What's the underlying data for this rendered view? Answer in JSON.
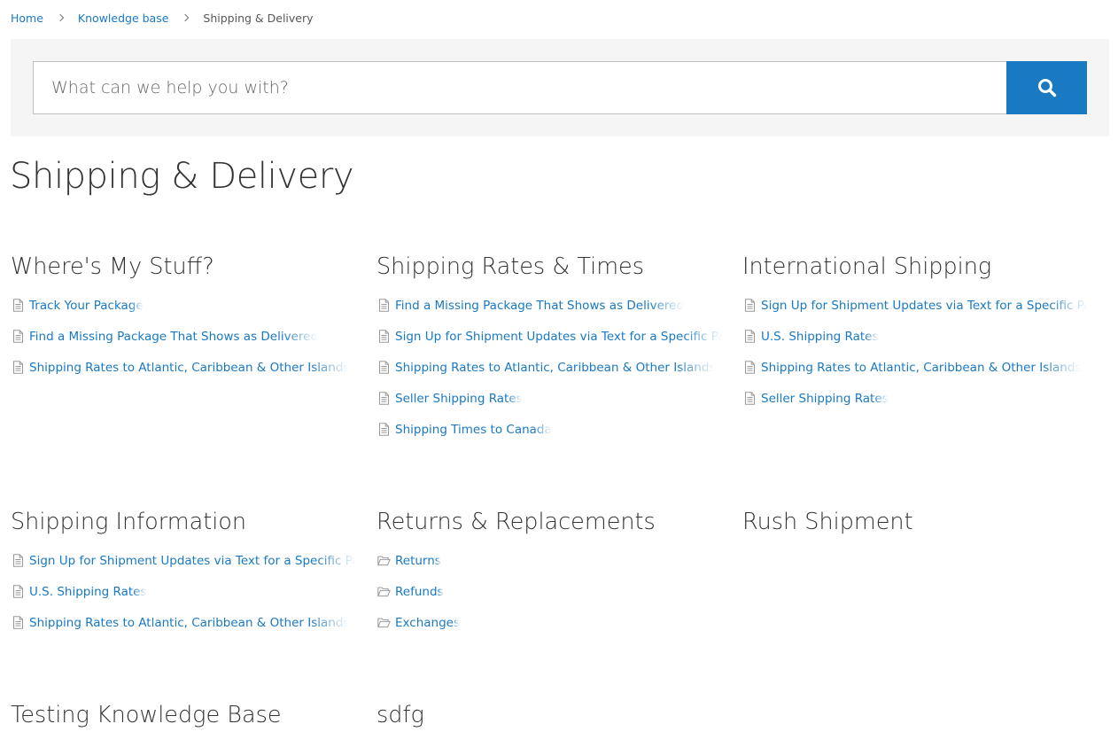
{
  "breadcrumb": {
    "home": "Home",
    "knowledge_base": "Knowledge base",
    "current": "Shipping & Delivery"
  },
  "search": {
    "placeholder": "What can we help you with?",
    "button_icon": "search-icon"
  },
  "page": {
    "title": "Shipping & Delivery"
  },
  "colors": {
    "link": "#1979c3",
    "accent_button": "#1979c3",
    "panel_bg": "#f5f5f5",
    "text": "#333333",
    "icon": "#999999"
  },
  "sections": [
    {
      "title": "Where's My Stuff?",
      "items": [
        {
          "label": "Track Your Package",
          "icon": "document-icon"
        },
        {
          "label": "Find a Missing Package That Shows as Delivered",
          "icon": "document-icon"
        },
        {
          "label": "Shipping Rates to Atlantic, Caribbean & Other Islands",
          "icon": "document-icon"
        }
      ]
    },
    {
      "title": "Shipping Rates & Times",
      "items": [
        {
          "label": "Find a Missing Package That Shows as Delivered",
          "icon": "document-icon"
        },
        {
          "label": "Sign Up for Shipment Updates via Text for a Specific Pa",
          "icon": "document-icon"
        },
        {
          "label": "Shipping Rates to Atlantic, Caribbean & Other Islands",
          "icon": "document-icon"
        },
        {
          "label": "Seller Shipping Rates",
          "icon": "document-icon"
        },
        {
          "label": "Shipping Times to Canada",
          "icon": "document-icon"
        }
      ]
    },
    {
      "title": "International Shipping",
      "items": [
        {
          "label": "Sign Up for Shipment Updates via Text for a Specific Pa",
          "icon": "document-icon"
        },
        {
          "label": "U.S. Shipping Rates",
          "icon": "document-icon"
        },
        {
          "label": "Shipping Rates to Atlantic, Caribbean & Other Islands",
          "icon": "document-icon"
        },
        {
          "label": "Seller Shipping Rates",
          "icon": "document-icon"
        }
      ]
    },
    {
      "title": "Shipping Information",
      "items": [
        {
          "label": "Sign Up for Shipment Updates via Text for a Specific Pa",
          "icon": "document-icon"
        },
        {
          "label": "U.S. Shipping Rates",
          "icon": "document-icon"
        },
        {
          "label": "Shipping Rates to Atlantic, Caribbean & Other Islands",
          "icon": "document-icon"
        }
      ]
    },
    {
      "title": "Returns & Replacements",
      "items": [
        {
          "label": "Returns",
          "icon": "folder-icon"
        },
        {
          "label": "Refunds",
          "icon": "folder-icon"
        },
        {
          "label": "Exchanges",
          "icon": "folder-icon"
        }
      ]
    },
    {
      "title": "Rush Shipment",
      "items": []
    },
    {
      "title": "Testing Knowledge Base",
      "items": []
    },
    {
      "title": "sdfg",
      "items": []
    }
  ]
}
